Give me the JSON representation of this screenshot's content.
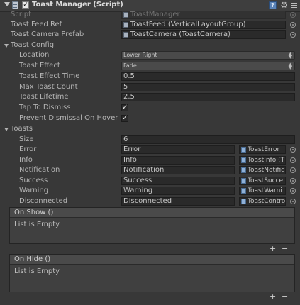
{
  "header": {
    "title": "Toast Manager (Script)",
    "enabled_mark": "✓"
  },
  "fields": {
    "script": {
      "label": "Script",
      "value": "ToastManager"
    },
    "toast_feed_ref": {
      "label": "Toast Feed Ref",
      "value": "ToastFeed (VerticalLayoutGroup)"
    },
    "toast_camera_prefab": {
      "label": "Toast Camera Prefab",
      "value": "ToastCamera (ToastCamera)"
    }
  },
  "toast_config": {
    "label": "Toast Config",
    "location": {
      "label": "Location",
      "value": "Lower Right"
    },
    "toast_effect": {
      "label": "Toast Effect",
      "value": "Fade"
    },
    "toast_effect_time": {
      "label": "Toast Effect Time",
      "value": "0.5"
    },
    "max_toast_count": {
      "label": "Max Toast Count",
      "value": "5"
    },
    "toast_lifetime": {
      "label": "Toast Lifetime",
      "value": "2.5"
    },
    "tap_to_dismiss": {
      "label": "Tap To Dismiss",
      "checked": true,
      "mark": "✓"
    },
    "prevent_dismissal": {
      "label": "Prevent Dismissal On Hover",
      "checked": true,
      "mark": "✓"
    }
  },
  "toasts": {
    "label": "Toasts",
    "size": {
      "label": "Size",
      "value": "6"
    },
    "items": [
      {
        "label": "Error",
        "name": "Error",
        "prefab": "ToastError"
      },
      {
        "label": "Info",
        "name": "Info",
        "prefab": "ToastInfo (T"
      },
      {
        "label": "Notification",
        "name": "Notification",
        "prefab": "ToastNotific"
      },
      {
        "label": "Success",
        "name": "Success",
        "prefab": "ToastSucce"
      },
      {
        "label": "Warning",
        "name": "Warning",
        "prefab": "ToastWarni"
      },
      {
        "label": "Disconnected",
        "name": "Disconnected",
        "prefab": "ToastContro"
      }
    ]
  },
  "events": {
    "on_show": {
      "title": "On Show ()",
      "empty": "List is Empty",
      "add": "+",
      "remove": "−"
    },
    "on_hide": {
      "title": "On Hide ()",
      "empty": "List is Empty",
      "add": "+",
      "remove": "−"
    }
  }
}
